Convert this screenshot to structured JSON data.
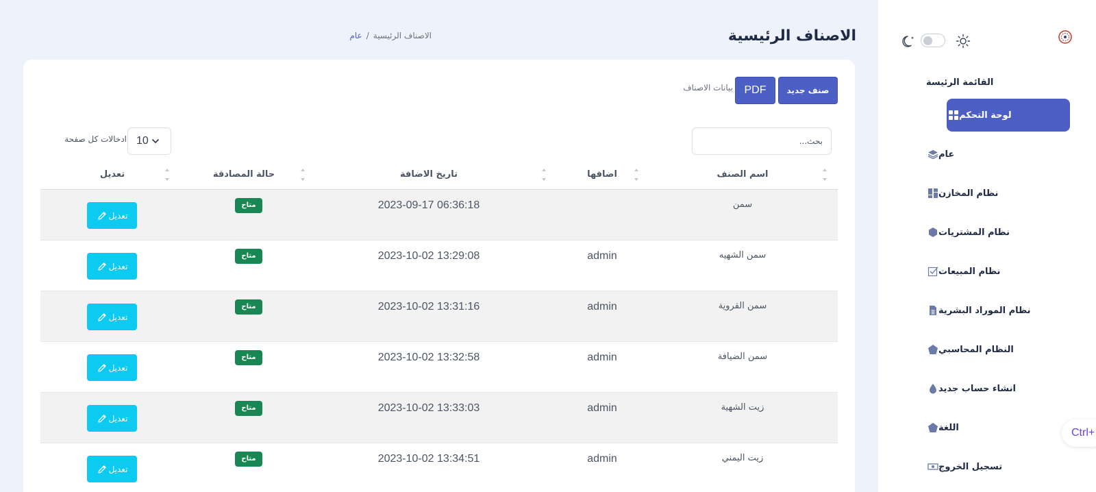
{
  "sidebar": {
    "theme_toggle_on": false,
    "items": [
      {
        "label": "القائمة الرئيسة",
        "icon": "none",
        "kind": "title"
      },
      {
        "label": "لوحة التحكم",
        "icon": "grid-icon",
        "kind": "active"
      },
      {
        "label": "عام",
        "icon": "layers-icon"
      },
      {
        "label": "نظام المخازن",
        "icon": "dashboard-icon"
      },
      {
        "label": "نظام المشتريات",
        "icon": "hexagon-icon"
      },
      {
        "label": "نظام المبيعات",
        "icon": "checkbox-icon"
      },
      {
        "label": "نظام الموراد البشرية",
        "icon": "spreadsheet-icon"
      },
      {
        "label": "النظام المحاسبي",
        "icon": "pentagon-icon"
      },
      {
        "label": "انشاء حساب جديد",
        "icon": "drop-icon"
      },
      {
        "label": "اللغة",
        "icon": "pentagon-icon"
      },
      {
        "label": "تسجيل الخروج",
        "icon": "cash-icon"
      }
    ]
  },
  "ctrl_badge": "Ctrl+",
  "header": {
    "title": "الاصناف الرئيسية",
    "breadcrumb_link": "عام",
    "breadcrumb_sep": "/",
    "breadcrumb_current": "الاصناف الرئيسية"
  },
  "toolbar": {
    "new_label": "صنف جديد",
    "pdf_label": "PDF",
    "data_label": "بيانات الاصناف",
    "search_placeholder": "بحث...",
    "per_page_value": "10",
    "per_page_label": "ادخالات كل صفحة"
  },
  "table": {
    "columns": [
      "اسم الصنف",
      "اضافها",
      "تاريخ الاضافة",
      "حالة المصادقة",
      "تعديل"
    ],
    "rows": [
      {
        "name": "سمن",
        "user": "",
        "date": "2023-09-17 06:36:18",
        "status": "متاح",
        "action": "تعديل"
      },
      {
        "name": "سمن الشهيه",
        "user": "admin",
        "date": "2023-10-02 13:29:08",
        "status": "متاح",
        "action": "تعديل"
      },
      {
        "name": "سمن القروية",
        "user": "admin",
        "date": "2023-10-02 13:31:16",
        "status": "متاح",
        "action": "تعديل"
      },
      {
        "name": "سمن الضيافة",
        "user": "admin",
        "date": "2023-10-02 13:32:58",
        "status": "متاح",
        "action": "تعديل"
      },
      {
        "name": "زيت الشهية",
        "user": "admin",
        "date": "2023-10-02 13:33:03",
        "status": "متاح",
        "action": "تعديل"
      },
      {
        "name": "زيت اليمني",
        "user": "admin",
        "date": "2023-10-02 13:34:51",
        "status": "متاح",
        "action": "تعديل"
      }
    ]
  },
  "colors": {
    "primary": "#4b5fc4",
    "success": "#198754",
    "info": "#0dcaf0",
    "background": "#eef3fb"
  }
}
